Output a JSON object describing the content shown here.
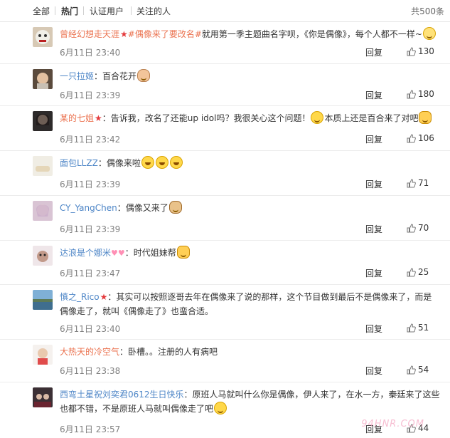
{
  "tabs": {
    "all": "全部",
    "hot": "热门",
    "verified": "认证用户",
    "following": "关注的人",
    "total": "共500条"
  },
  "actions": {
    "reply": "回复"
  },
  "comments": [
    {
      "user": "曾经幻想走天涯",
      "topic": "#偶像来了要改名#",
      "text": "就用第一季主题曲名字呗，《你是偶像》，每个人都不一样~",
      "date": "6月11日 23:40",
      "likes": "130"
    },
    {
      "user": "一只拉姬",
      "text": "：百合花开",
      "date": "6月11日 23:39",
      "likes": "180"
    },
    {
      "user": "某的七姐",
      "text": "：告诉我，改名了还能up idol吗？我很关心这个问题！",
      "text2": "本质上还是百合来了对吧",
      "date": "6月11日 23:42",
      "likes": "106"
    },
    {
      "user": "面包LLZZ",
      "text": "：偶像来啦",
      "date": "6月11日 23:39",
      "likes": "71"
    },
    {
      "user": "CY_YangChen",
      "text": "：偶像又来了",
      "date": "6月11日 23:39",
      "likes": "70"
    },
    {
      "user": "达浪是个娜米",
      "text": "：时代姐妹帮",
      "date": "6月11日 23:47",
      "likes": "25"
    },
    {
      "user": "慎之_Rico",
      "text": "：其实可以按照逐哥去年在偶像来了说的那样，这个节目做到最后不是偶像来了，而是偶像走了，就叫《偶像走了》也蛮合适。",
      "date": "6月11日 23:40",
      "likes": "51"
    },
    {
      "user": "大热天的冷空气",
      "text": "：卧槽。。注册的人有病吧",
      "date": "6月11日 23:38",
      "likes": "54"
    },
    {
      "user": "西弯土星祝刘奕君0612生日快乐",
      "text": "：原班人马就叫什么你是偶像，伊人来了，在水一方，秦廷来了这些也都不错，不是原班人马就叫偶像走了吧",
      "date": "6月11日 23:57",
      "likes": "44"
    }
  ],
  "watermark": "94HNR.COM",
  "colors": {
    "username": "#eb7350",
    "username_blue": "#4e86c7",
    "vip_star": "#e4393c",
    "date": "#808080"
  }
}
